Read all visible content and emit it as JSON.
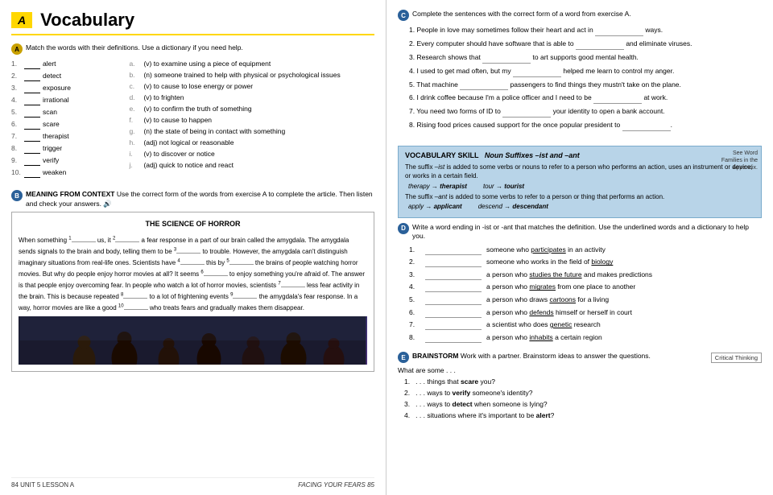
{
  "header": {
    "badge": "A",
    "title": "Vocabulary"
  },
  "left": {
    "sectionA": {
      "label": "A",
      "instruction": "Match the words with their definitions. Use a dictionary if you need help.",
      "words": [
        {
          "num": "1.",
          "blank": "___",
          "word": "alert"
        },
        {
          "num": "2.",
          "blank": "___",
          "word": "detect"
        },
        {
          "num": "3.",
          "blank": "___",
          "word": "exposure"
        },
        {
          "num": "4.",
          "blank": "___",
          "word": "irrational"
        },
        {
          "num": "5.",
          "blank": "___",
          "word": "scan"
        },
        {
          "num": "6.",
          "blank": "___",
          "word": "scare"
        },
        {
          "num": "7.",
          "blank": "___",
          "word": "therapist"
        },
        {
          "num": "8.",
          "blank": "___",
          "word": "trigger"
        },
        {
          "num": "9.",
          "blank": "___",
          "word": "verify"
        },
        {
          "num": "10.",
          "blank": "___",
          "word": "weaken"
        }
      ],
      "defs": [
        {
          "label": "a.",
          "text": "(v) to examine using a piece of equipment"
        },
        {
          "label": "b.",
          "text": "(n) someone trained to help with physical or psychological issues"
        },
        {
          "label": "c.",
          "text": "(v) to cause to lose energy or power"
        },
        {
          "label": "d.",
          "text": "(v) to frighten"
        },
        {
          "label": "e.",
          "text": "(v) to confirm the truth of something"
        },
        {
          "label": "f.",
          "text": "(v) to cause to happen"
        },
        {
          "label": "g.",
          "text": "(n) the state of being in contact with something"
        },
        {
          "label": "h.",
          "text": "(adj) not logical or reasonable"
        },
        {
          "label": "i.",
          "text": "(v) to discover or notice"
        },
        {
          "label": "j.",
          "text": "(adj) quick to notice and react"
        }
      ]
    },
    "sectionB": {
      "label": "B",
      "instruction": "MEANING FROM CONTEXT  Use the correct form of the words from exercise A to complete the article. Then listen and check your answers.",
      "article": {
        "title": "THE SCIENCE OF HORROR",
        "paragraphs": [
          "When something [1] us, it [2] a fear response in a part of our brain called the amygdala. The amygdala sends signals to the brain and body, telling them to be [3] to trouble. However, the amygdala can't distinguish imaginary situations from real-life ones. Scientists have [4] this by [5] the brains of people watching horror movies. But why do people enjoy horror movies at all? It seems [6] to enjoy something you're afraid of. The answer is that people enjoy overcoming fear. In people who watch a lot of horror movies, scientists [7] less fear activity in the brain. This is because repeated [8] to a lot of frightening events [9] the amygdala's fear response. In a way, horror movies are like a good [10] who treats fears and gradually makes them disappear."
        ]
      }
    },
    "footer": {
      "left": "84  UNIT 5  LESSON A",
      "right": "FACING YOUR FEARS  85"
    }
  },
  "right": {
    "sectionC": {
      "label": "C",
      "instruction": "Complete the sentences with the correct form of a word from exercise A.",
      "sentences": [
        {
          "num": "1",
          "text": "People in love may sometimes follow their heart and act in",
          "blank": true,
          "end": "ways."
        },
        {
          "num": "2",
          "text": "Every computer should have software that is able to",
          "blank": true,
          "end": "and eliminate viruses."
        },
        {
          "num": "3",
          "text": "Research shows that",
          "blank": true,
          "end": "to art supports good mental health."
        },
        {
          "num": "4",
          "text": "I used to get mad often, but my",
          "blank": true,
          "end": "helped me learn to control my anger."
        },
        {
          "num": "5",
          "text": "That machine",
          "blank": true,
          "end": "passengers to find things they mustn't take on the plane."
        },
        {
          "num": "6",
          "text": "I drink coffee because I'm a police officer and I need to be",
          "blank": true,
          "end": "at work."
        },
        {
          "num": "7",
          "text": "You need two forms of ID to",
          "blank": true,
          "end": "your identity to open a bank account."
        },
        {
          "num": "8",
          "text": "Rising food prices caused support for the once popular president to",
          "blank": true,
          "end": ""
        }
      ]
    },
    "vocabSkill": {
      "title": "VOCABULARY SKILL",
      "subtitle": "Noun Suffixes –ist and –ant",
      "body1": "The suffix –ist is added to some verbs or nouns to refer to a person who performs an action, uses an instrument or device, or works in a certain field.",
      "example1a": "therapy → therapist",
      "example1b": "tour → tourist",
      "body2": "The suffix –ant is added to some verbs to refer to a person or thing that performs an action.",
      "example2a": "apply → applicant",
      "example2b": "descend → descendant",
      "seeWord": "See Word\nFamilies in the\nAppendix."
    },
    "sectionD": {
      "label": "D",
      "instruction": "Write a word ending in -ist or -ant that matches the definition. Use the underlined words and a dictionary to help you.",
      "items": [
        {
          "num": "1.",
          "text": "someone who participates in an activity"
        },
        {
          "num": "2.",
          "text": "someone who works in the field of biology"
        },
        {
          "num": "3.",
          "text": "a person who studies the future and makes predictions"
        },
        {
          "num": "4.",
          "text": "a person who migrates from one place to another"
        },
        {
          "num": "5.",
          "text": "a person who draws cartoons for a living"
        },
        {
          "num": "6.",
          "text": "a person who defends himself or herself in court"
        },
        {
          "num": "7.",
          "text": "a scientist who does genetic research"
        },
        {
          "num": "8.",
          "text": "a person who inhabits a certain region"
        }
      ]
    },
    "sectionE": {
      "label": "E",
      "instruction": "BRAINSTORM  Work with a partner. Brainstorm ideas to answer the questions.",
      "criticalThinking": "Critical Thinking",
      "subtext": "What are some . . .",
      "items": [
        {
          "text": ". . . things that scare you?",
          "bold": "scare"
        },
        {
          "text": ". . . ways to verify someone's identity?",
          "bold": "verify"
        },
        {
          "text": ". . . ways to detect when someone is lying?",
          "bold": "detect"
        },
        {
          "text": ". . . situations where it's important to be alert?",
          "bold": "alert"
        }
      ]
    }
  }
}
